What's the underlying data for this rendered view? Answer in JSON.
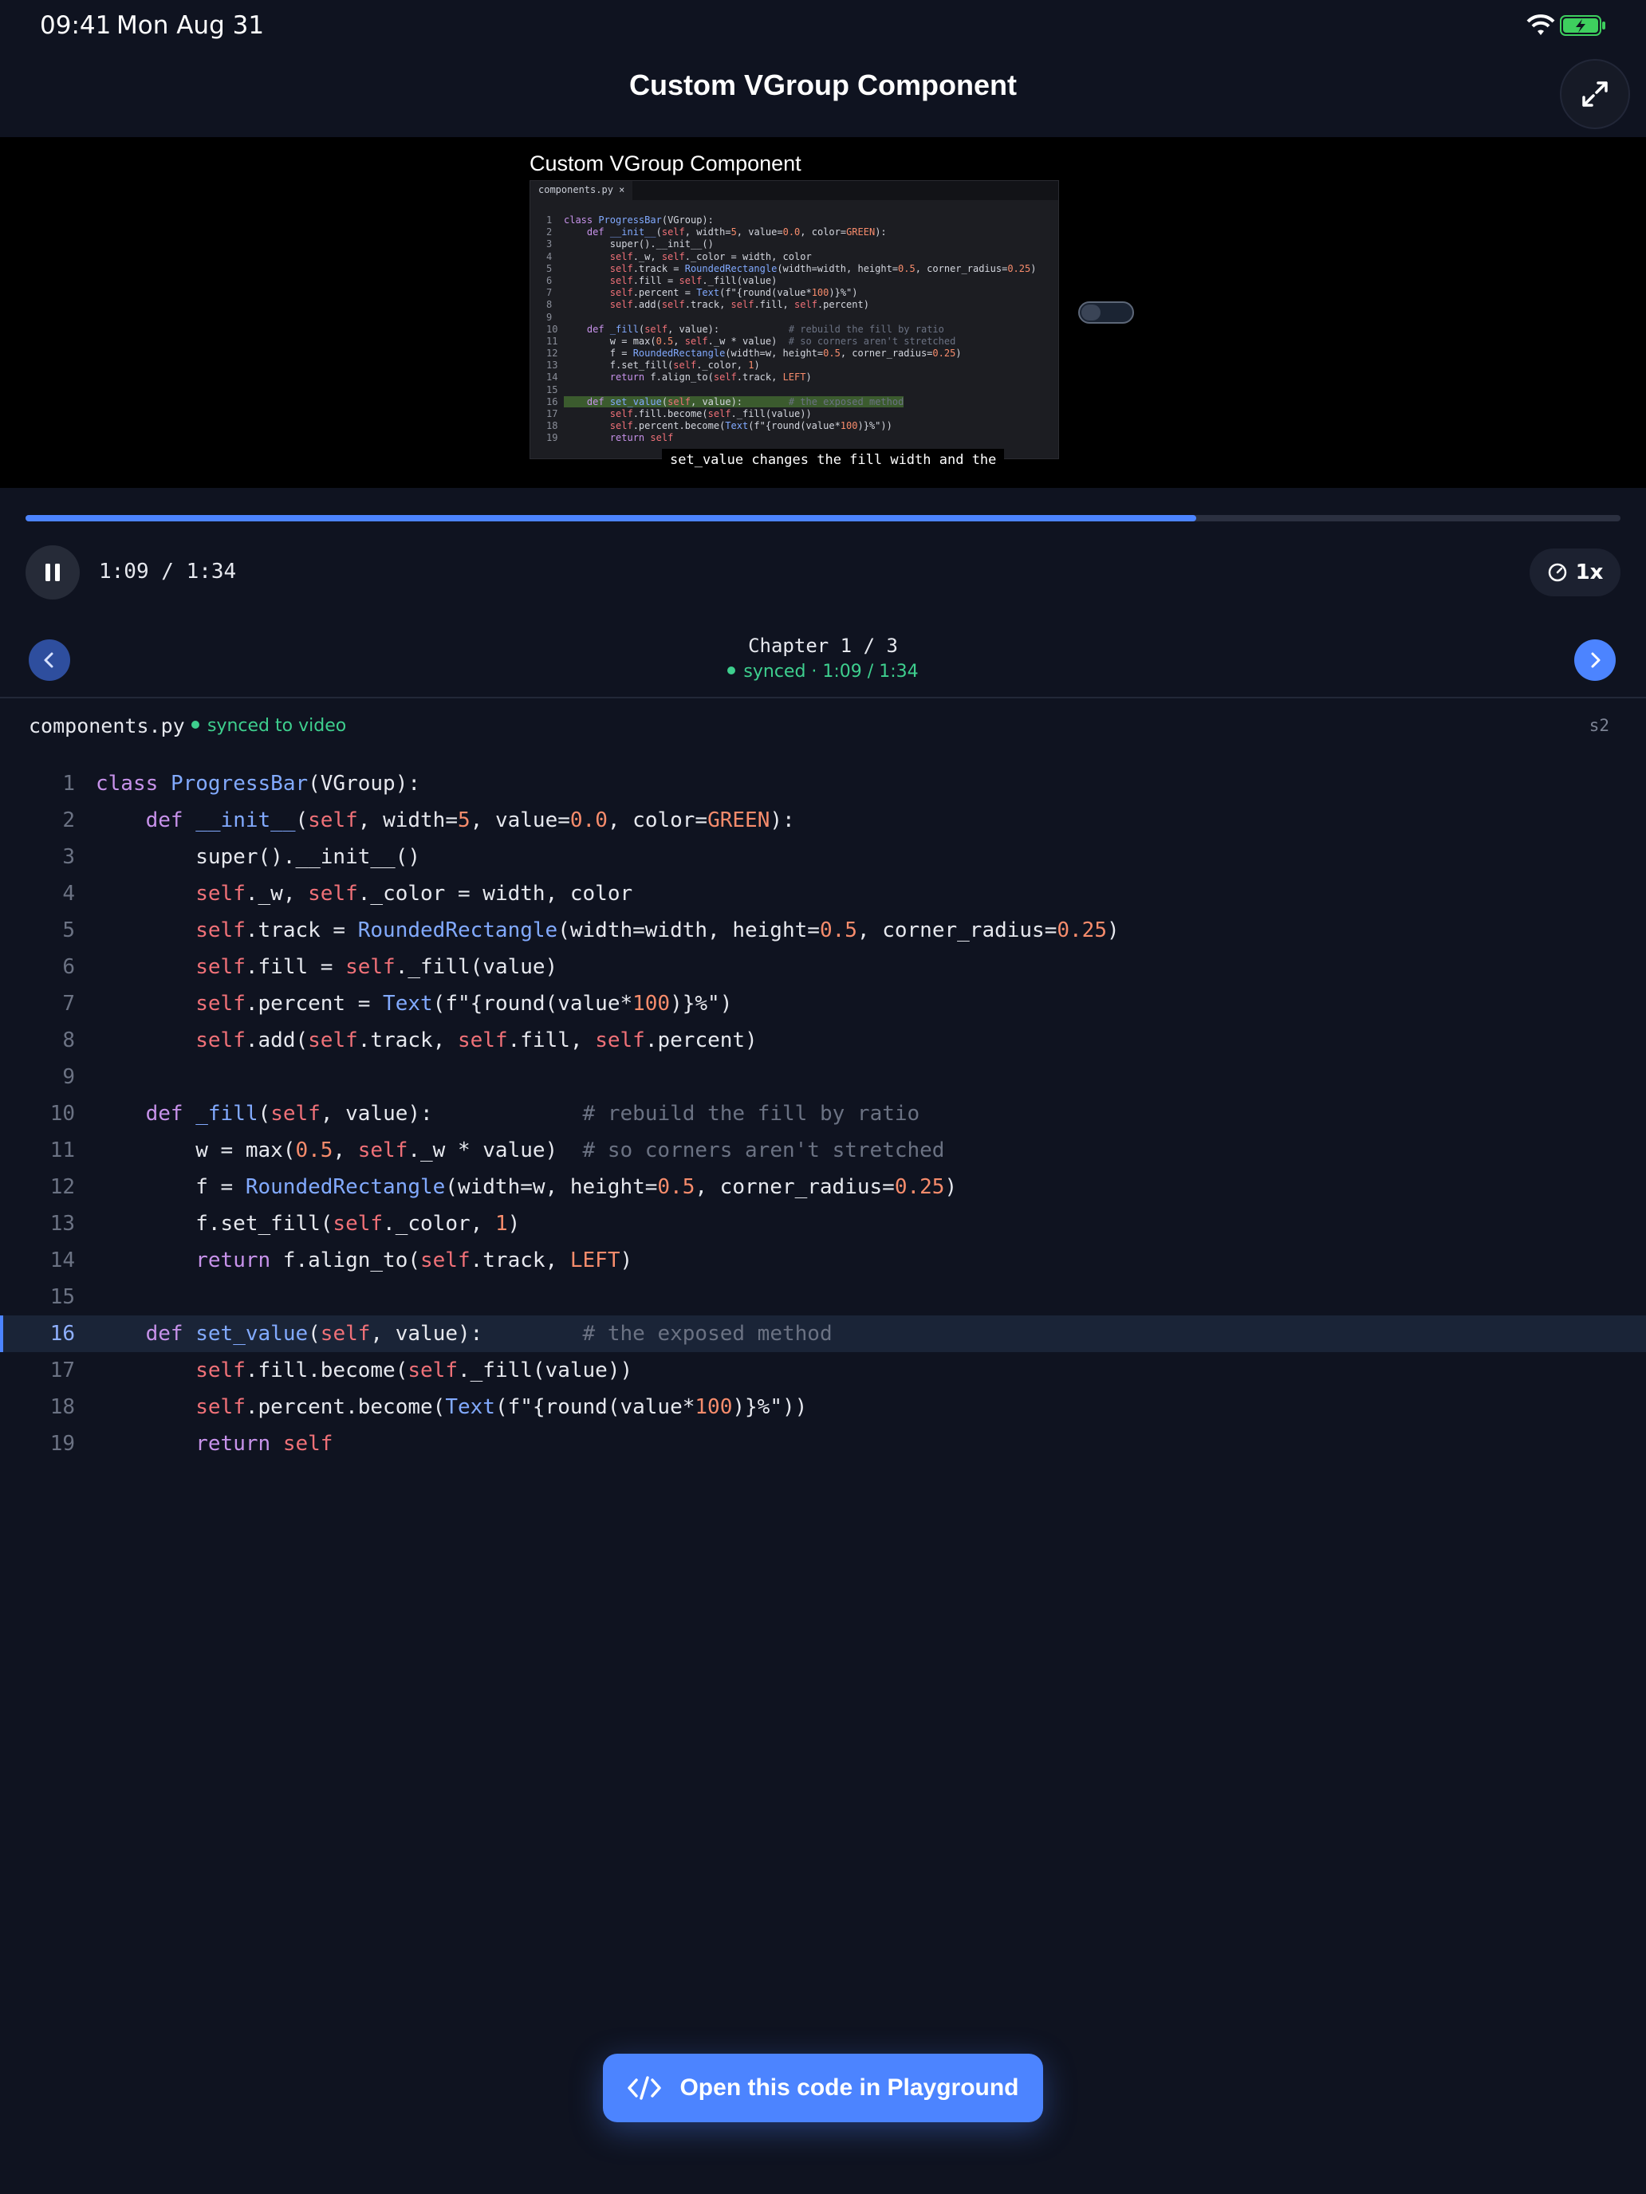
{
  "status": {
    "time": "09:41",
    "date": "Mon Aug 31"
  },
  "header": {
    "title": "Custom VGroup Component"
  },
  "video": {
    "frame_title": "Custom VGroup Component",
    "tab_label": "components.py ×",
    "caption": "set_value changes the fill width and the"
  },
  "player": {
    "progress_percent": 73.4,
    "timecode": "1:09 / 1:34",
    "speed": "1x"
  },
  "chapter": {
    "label": "Chapter 1 / 3",
    "sync": "synced · 1:09 / 1:34"
  },
  "file": {
    "name": "components.py",
    "sync_label": "synced to video",
    "section": "s2"
  },
  "code": {
    "active_line": 16,
    "lines": [
      "class ProgressBar(VGroup):",
      "    def __init__(self, width=5, value=0.0, color=GREEN):",
      "        super().__init__()",
      "        self._w, self._color = width, color",
      "        self.track = RoundedRectangle(width=width, height=0.5, corner_radius=0.25)",
      "        self.fill = self._fill(value)",
      "        self.percent = Text(f\"{round(value*100)}%\")",
      "        self.add(self.track, self.fill, self.percent)",
      "",
      "    def _fill(self, value):            # rebuild the fill by ratio",
      "        w = max(0.5, self._w * value)  # so corners aren't stretched",
      "        f = RoundedRectangle(width=w, height=0.5, corner_radius=0.25)",
      "        f.set_fill(self._color, 1)",
      "        return f.align_to(self.track, LEFT)",
      "",
      "    def set_value(self, value):        # the exposed method",
      "        self.fill.become(self._fill(value))",
      "        self.percent.become(Text(f\"{round(value*100)}%\"))",
      "        return self"
    ]
  },
  "cta": {
    "label": "Open this code in Playground"
  },
  "icons": {
    "expand": "expand-icon",
    "pause": "pause-icon",
    "speed": "speed-gauge-icon",
    "prev": "chevron-left-icon",
    "next": "chevron-right-icon",
    "code": "code-icon"
  },
  "colors": {
    "accent": "#4c84ff",
    "sync": "#3ecf8e",
    "background": "#0f1320"
  }
}
